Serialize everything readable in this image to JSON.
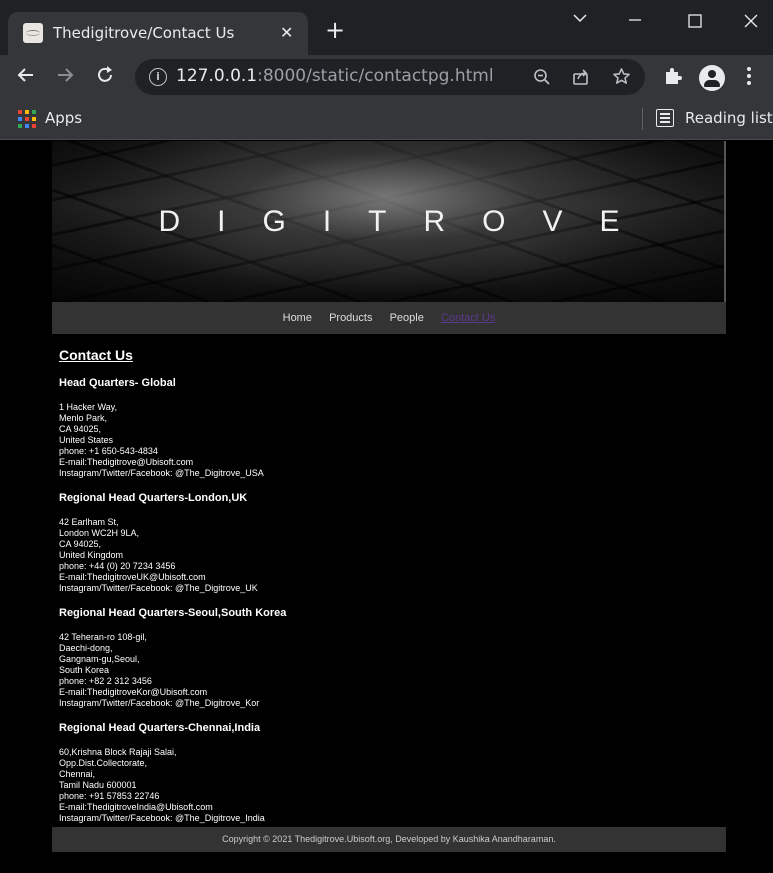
{
  "browser": {
    "tab_title": "Thedigitrove/Contact Us",
    "url_host": "127.0.0.1",
    "url_path": ":8000/static/contactpg.html",
    "bookmarks": {
      "apps_label": "Apps",
      "reading_list_label": "Reading list"
    }
  },
  "banner": {
    "title": "DIGITROVE"
  },
  "nav": {
    "items": [
      {
        "label": "Home"
      },
      {
        "label": "Products"
      },
      {
        "label": "People"
      },
      {
        "label": "Contact Us"
      }
    ]
  },
  "contact": {
    "heading": "Contact Us",
    "offices": [
      {
        "title": "Head Quarters- Global",
        "lines": [
          "1 Hacker Way,",
          "Menlo Park,",
          "CA 94025,",
          "United States",
          "phone: +1 650-543-4834",
          "E-mail:Thedigitrove@Ubisoft.com",
          "Instagram/Twitter/Facebook: @The_Digitrove_USA"
        ]
      },
      {
        "title": "Regional Head Quarters-London,UK",
        "lines": [
          "42 Earlham St,",
          "London WC2H 9LA,",
          "CA 94025,",
          "United Kingdom",
          "phone: +44 (0) 20 7234 3456",
          "E-mail:ThedigitroveUK@Ubisoft.com",
          "Instagram/Twitter/Facebook: @The_Digitrove_UK"
        ]
      },
      {
        "title": "Regional Head Quarters-Seoul,South Korea",
        "lines": [
          "42 Teheran-ro 108-gil,",
          "Daechi-dong,",
          "Gangnam-gu,Seoul,",
          "South Korea",
          "phone: +82 2 312 3456",
          "E-mail:ThedigitroveKor@Ubisoft.com",
          "Instagram/Twitter/Facebook: @The_Digitrove_Kor"
        ]
      },
      {
        "title": "Regional Head Quarters-Chennai,India",
        "lines": [
          "60,Krishna Block Rajaji Salai,",
          "Opp.Dist.Collectorate,",
          "Chennai,",
          "Tamil Nadu 600001",
          "phone: +91 57853 22746",
          "E-mail:ThedigitroveIndia@Ubisoft.com",
          "Instagram/Twitter/Facebook: @The_Digitrove_India"
        ]
      }
    ]
  },
  "footer": {
    "text": "Copyright © 2021 Thedigitrove.Ubisoft.org, Developed by Kaushika Anandharaman."
  }
}
